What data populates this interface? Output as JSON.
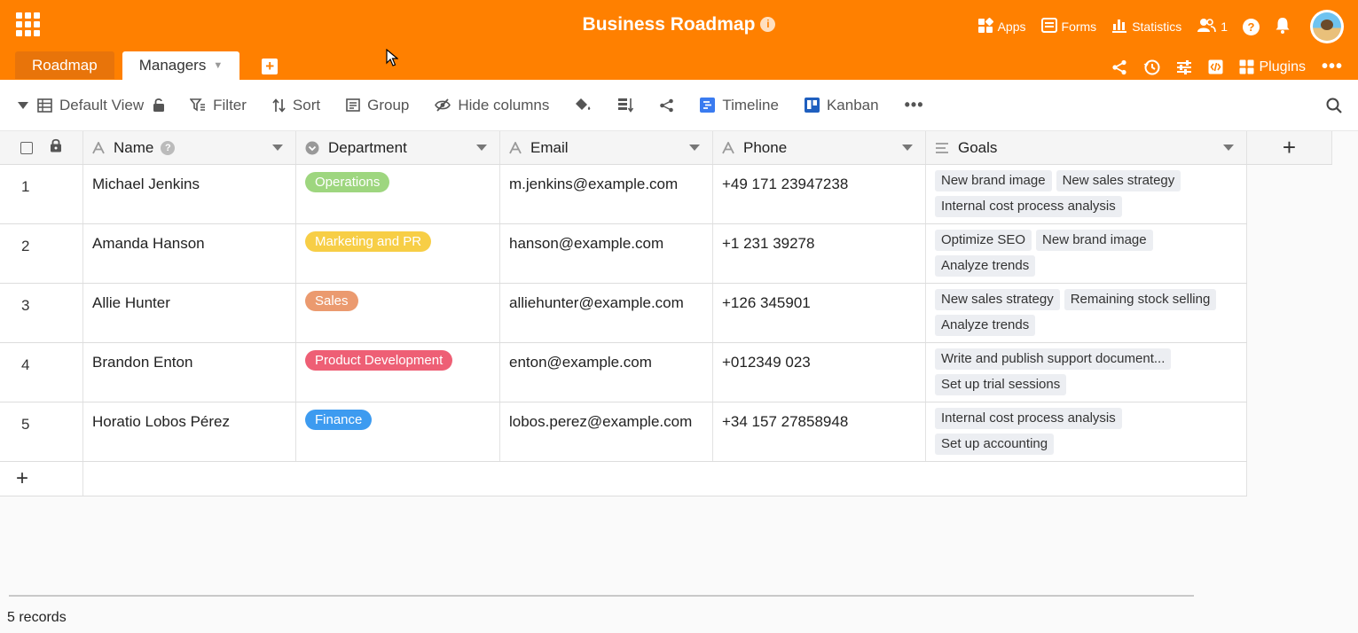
{
  "header": {
    "title": "Business Roadmap",
    "info_glyph": "i",
    "apps_label": "Apps",
    "forms_label": "Forms",
    "statistics_label": "Statistics",
    "collaborators_count": "1",
    "help_glyph": "?"
  },
  "tabs": [
    {
      "label": "Roadmap",
      "active": false
    },
    {
      "label": "Managers",
      "active": true
    }
  ],
  "toolbar_right": {
    "plugins_label": "Plugins"
  },
  "viewbar": {
    "view_name": "Default View",
    "filter_label": "Filter",
    "sort_label": "Sort",
    "group_label": "Group",
    "hide_columns_label": "Hide columns",
    "timeline_label": "Timeline",
    "kanban_label": "Kanban"
  },
  "columns": [
    {
      "label": "Name",
      "icon": "text-icon"
    },
    {
      "label": "Department",
      "icon": "single-select-icon"
    },
    {
      "label": "Email",
      "icon": "text-icon"
    },
    {
      "label": "Phone",
      "icon": "text-icon"
    },
    {
      "label": "Goals",
      "icon": "multi-select-icon"
    }
  ],
  "colors": {
    "accent": "#ff8000",
    "Operations": "#9ed67f",
    "Marketing and PR": "#f7ce46",
    "Sales": "#eb9a6f",
    "Product Development": "#ee5f75",
    "Finance": "#3d9bf0"
  },
  "rows": [
    {
      "num": "1",
      "name": "Michael Jenkins",
      "department": "Operations",
      "dep_color": "#9ed67f",
      "email": "m.jenkins@example.com",
      "phone": "+49 171 23947238",
      "goals": [
        "New brand image",
        "New sales strategy",
        "Internal cost process analysis"
      ]
    },
    {
      "num": "2",
      "name": "Amanda Hanson",
      "department": "Marketing and PR",
      "dep_color": "#f7ce46",
      "email": "hanson@example.com",
      "phone": "+1 231 39278",
      "goals": [
        "Optimize SEO",
        "New brand image",
        "Analyze trends"
      ]
    },
    {
      "num": "3",
      "name": "Allie Hunter",
      "department": "Sales",
      "dep_color": "#eb9a6f",
      "email": "alliehunter@example.com",
      "phone": "+126 345901",
      "goals": [
        "New sales strategy",
        "Remaining stock selling",
        "Analyze trends"
      ]
    },
    {
      "num": "4",
      "name": "Brandon Enton",
      "department": "Product Development",
      "dep_color": "#ee5f75",
      "email": "enton@example.com",
      "phone": "+012349 023",
      "goals": [
        "Write and publish support document...",
        "Set up trial sessions"
      ]
    },
    {
      "num": "5",
      "name": "Horatio Lobos Pérez",
      "department": "Finance",
      "dep_color": "#3d9bf0",
      "email": "lobos.perez@example.com",
      "phone": "+34 157 27858948",
      "goals": [
        "Internal cost process analysis",
        "Set up accounting"
      ]
    }
  ],
  "footer": {
    "records": "5 records"
  }
}
